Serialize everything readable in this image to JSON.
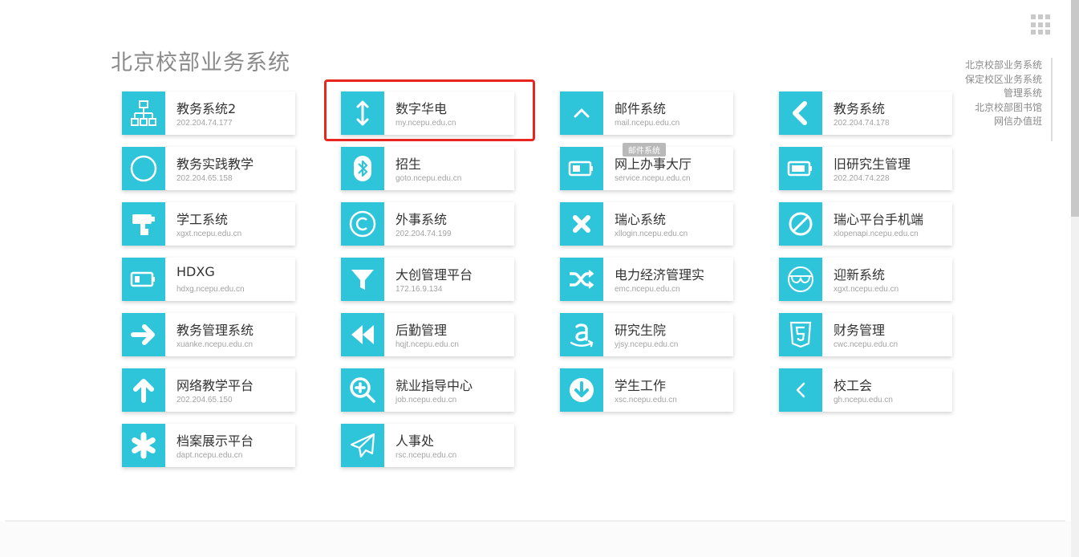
{
  "page_title": "北京校部业务系统",
  "side_nav": [
    "北京校部业务系统",
    "保定校区业务系统",
    "管理系统",
    "北京校部图书馆",
    "网信办值班"
  ],
  "tooltip": "邮件系统",
  "colors": {
    "accent": "#2ec5db",
    "highlight": "#e8251e"
  },
  "tiles": [
    {
      "name": "教务系统2",
      "url": "202.204.74.177",
      "icon": "sitemap-icon"
    },
    {
      "name": "数字华电",
      "url": "my.ncepu.edu.cn",
      "icon": "arrows-vertical-icon"
    },
    {
      "name": "邮件系统",
      "url": "mail.ncepu.edu.cn",
      "icon": "chevron-up-icon"
    },
    {
      "name": "教务系统",
      "url": "202.204.74.178",
      "icon": "chevron-left-bold-icon"
    },
    {
      "name": "教务实践教学",
      "url": "202.204.65.158",
      "icon": "circle-icon"
    },
    {
      "name": "招生",
      "url": "goto.ncepu.edu.cn",
      "icon": "bluetooth-icon"
    },
    {
      "name": "网上办事大厅",
      "url": "service.ncepu.edu.cn",
      "icon": "battery-icon"
    },
    {
      "name": "旧研究生管理",
      "url": "202.204.74.228",
      "icon": "battery-icon"
    },
    {
      "name": "学工系统",
      "url": "xgxt.ncepu.edu.cn",
      "icon": "paint-roller-icon"
    },
    {
      "name": "外事系统",
      "url": "202.204.74.199",
      "icon": "copyright-icon"
    },
    {
      "name": "瑞心系统",
      "url": "xllogin.ncepu.edu.cn",
      "icon": "close-icon"
    },
    {
      "name": "瑞心平台手机端",
      "url": "xlopenapi.ncepu.edu.cn",
      "icon": "ban-icon"
    },
    {
      "name": "HDXG",
      "url": "hdxg.ncepu.edu.cn",
      "icon": "battery-icon"
    },
    {
      "name": "大创管理平台",
      "url": "172.16.9.134",
      "icon": "filter-icon"
    },
    {
      "name": "电力经济管理实",
      "url": "emc.ncepu.edu.cn",
      "icon": "shuffle-icon"
    },
    {
      "name": "迎新系统",
      "url": "xgxt.ncepu.edu.cn",
      "icon": "glasses-icon"
    },
    {
      "name": "教务管理系统",
      "url": "xuanke.ncepu.edu.cn",
      "icon": "arrow-right-icon"
    },
    {
      "name": "后勤管理",
      "url": "hqjt.ncepu.edu.cn",
      "icon": "backward-icon"
    },
    {
      "name": "研究生院",
      "url": "yjsy.ncepu.edu.cn",
      "icon": "amazon-icon"
    },
    {
      "name": "财务管理",
      "url": "cwc.ncepu.edu.cn",
      "icon": "html5-icon"
    },
    {
      "name": "网络教学平台",
      "url": "202.204.65.150",
      "icon": "arrow-up-icon"
    },
    {
      "name": "就业指导中心",
      "url": "job.ncepu.edu.cn",
      "icon": "search-plus-icon"
    },
    {
      "name": "学生工作",
      "url": "xsc.ncepu.edu.cn",
      "icon": "arrow-circle-down-icon"
    },
    {
      "name": "校工会",
      "url": "gh.ncepu.edu.cn",
      "icon": "chevron-left-icon"
    },
    {
      "name": "档案展示平台",
      "url": "dapt.ncepu.edu.cn",
      "icon": "asterisk-icon"
    },
    {
      "name": "人事处",
      "url": "rsc.ncepu.edu.cn",
      "icon": "paper-plane-icon"
    }
  ]
}
